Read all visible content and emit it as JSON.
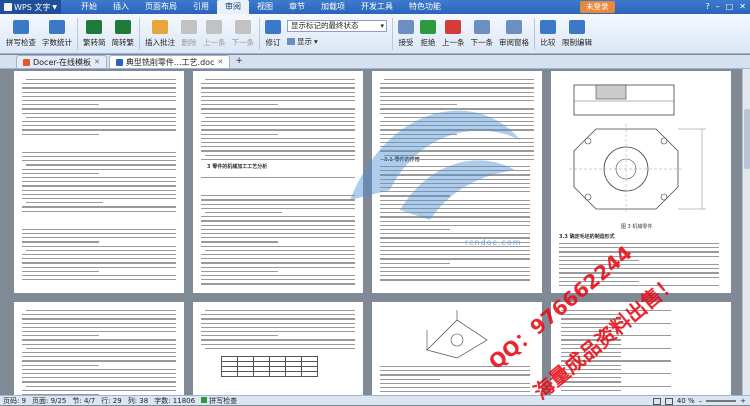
{
  "app": {
    "name": "WPS 文字",
    "menus": [
      "开始",
      "插入",
      "页面布局",
      "引用",
      "审阅",
      "视图",
      "章节",
      "加载项",
      "开发工具",
      "特色功能"
    ],
    "active_menu": "审阅",
    "login": "未登录"
  },
  "ribbon": {
    "spell_check": "拼写检查",
    "word_count": "字数统计",
    "trad_to_simp": "繁转简",
    "simp_to_trad": "简转繁",
    "insert_comment": "插入批注",
    "delete": "删除",
    "prev_comment": "上一条",
    "next_comment": "下一条",
    "revise": "修订",
    "track_mode": "显示标记的最终状态",
    "display": "显示",
    "accept": "接受",
    "reject": "拒绝",
    "prev": "上一条",
    "next": "下一条",
    "review_pane": "审阅窗格",
    "compare": "比较",
    "restrict_edit": "限制编辑",
    "icon_colors": [
      "#3b78c8",
      "#3b78c8",
      "#1f7a3a",
      "#1f7a3a",
      "#e7a63a",
      "#c2c2c2",
      "#c2c2c2",
      "#c2c2c2",
      "#3b78c8",
      "#6b8fc2",
      "#2e9a3e",
      "#d43c3c",
      "#6b8fc2",
      "#6b8fc2",
      "#3b78c8",
      "#3b78c8",
      "#c78a2c"
    ]
  },
  "tabs": [
    {
      "label": "Docer-在线模板",
      "active": false
    },
    {
      "label": "典型铣削零件...工艺.doc",
      "active": true
    }
  ],
  "pages": {
    "p2_heading": "3 零件的机械加工工艺分析",
    "p4_caption": "图 3 机械零件",
    "p4_heading": "3.3 确定毛坯的制造形式"
  },
  "ads": {
    "qq": "QQ：976662244",
    "slogan": "海量成品资料出售！",
    "watermark": "rcndoc.com"
  },
  "status": {
    "page": "页码: 9",
    "pages": "页面: 9/25",
    "section": "节: 4/7",
    "row": "行: 29",
    "col": "列: 38",
    "words": "字数: 11806",
    "spell": "拼写检查",
    "zoom": "40 %"
  }
}
